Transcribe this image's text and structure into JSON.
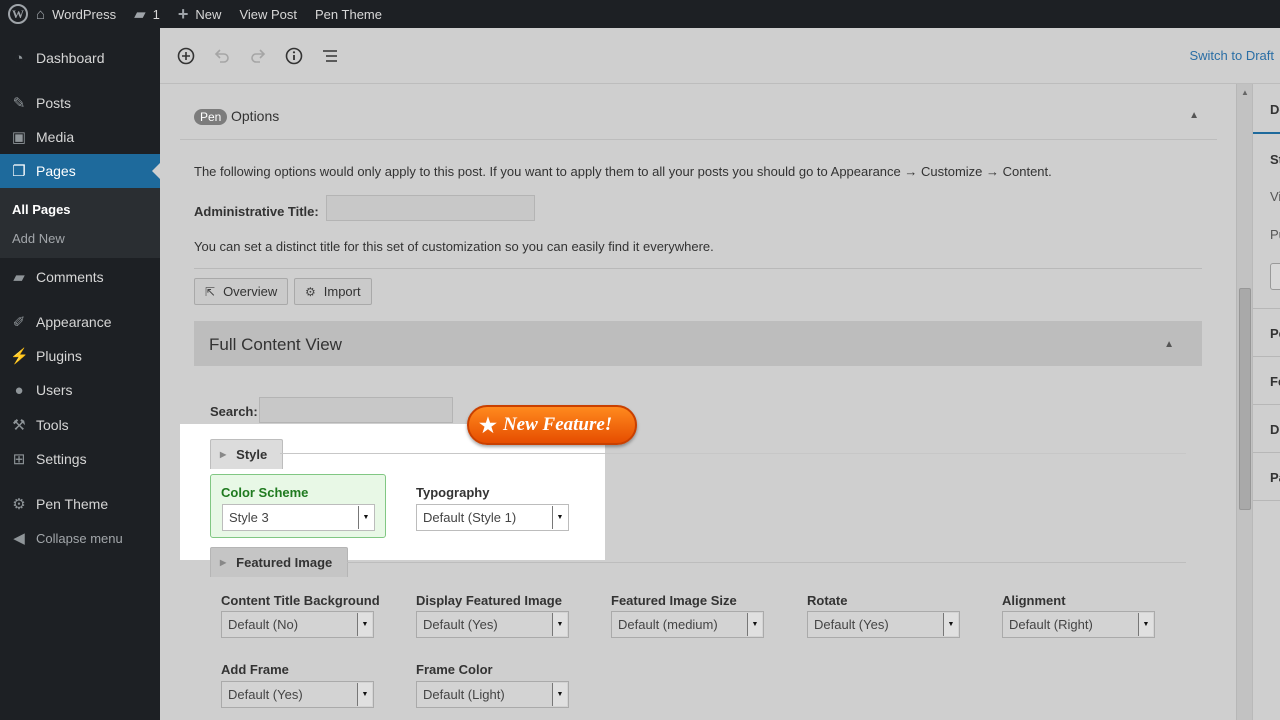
{
  "admin_bar": {
    "site": "WordPress",
    "comments": "1",
    "new": "New",
    "view_post": "View Post",
    "theme": "Pen Theme"
  },
  "sidebar": {
    "items": [
      {
        "label": "Dashboard",
        "icon": "dashboard-icon"
      },
      {
        "label": "Posts",
        "icon": "pin-icon"
      },
      {
        "label": "Media",
        "icon": "media-icon"
      },
      {
        "label": "Pages",
        "icon": "pages-icon"
      },
      {
        "label": "Comments",
        "icon": "comment-icon"
      },
      {
        "label": "Appearance",
        "icon": "brush-icon"
      },
      {
        "label": "Plugins",
        "icon": "plug-icon"
      },
      {
        "label": "Users",
        "icon": "user-icon"
      },
      {
        "label": "Tools",
        "icon": "wrench-icon"
      },
      {
        "label": "Settings",
        "icon": "settings-icon"
      },
      {
        "label": "Pen Theme",
        "icon": "gear-icon"
      },
      {
        "label": "Collapse menu",
        "icon": "collapse-icon"
      }
    ],
    "submenu": [
      "All Pages",
      "Add New"
    ]
  },
  "toolbar": {
    "switch_draft": "Switch to Draft"
  },
  "right_panel": {
    "items": [
      "Do",
      "St",
      "Vi",
      "Pu",
      "Pe",
      "Fe",
      "Di",
      "Pa"
    ]
  },
  "pen_options": {
    "badge": "Pen",
    "title": "Options",
    "intro": "The following options would only apply to this post. If you want to apply them to all your posts you should go to Appearance → Customize → Content.",
    "admin_title_label": "Administrative Title:",
    "admin_title_value": "",
    "admin_title_help": "You can set a distinct title for this set of customization so you can easily find it everywhere.",
    "overview_button": "Overview",
    "import_button": "Import"
  },
  "full_content_view": {
    "title": "Full Content View",
    "search_label": "Search:",
    "search_value": "",
    "new_feature": "New Feature!",
    "style_tab": "Style",
    "featured_image_tab": "Featured Image",
    "style_fields": [
      {
        "label": "Color Scheme",
        "value": "Style 3"
      },
      {
        "label": "Typography",
        "value": "Default (Style 1)"
      }
    ],
    "featured_fields": [
      {
        "label": "Content Title Background",
        "value": "Default (No)"
      },
      {
        "label": "Display Featured Image",
        "value": "Default (Yes)"
      },
      {
        "label": "Featured Image Size",
        "value": "Default (medium)"
      },
      {
        "label": "Rotate",
        "value": "Default (Yes)"
      },
      {
        "label": "Alignment",
        "value": "Default (Right)"
      },
      {
        "label": "Add Frame",
        "value": "Default (Yes)"
      },
      {
        "label": "Frame Color",
        "value": "Default (Light)"
      }
    ]
  },
  "colors": {
    "admin_bar": "#1d2024",
    "active_menu": "#1e6a9c",
    "link": "#2a6ea5",
    "new_feature": "#f06a0c",
    "color_scheme_highlight": "#e8f8e6"
  }
}
